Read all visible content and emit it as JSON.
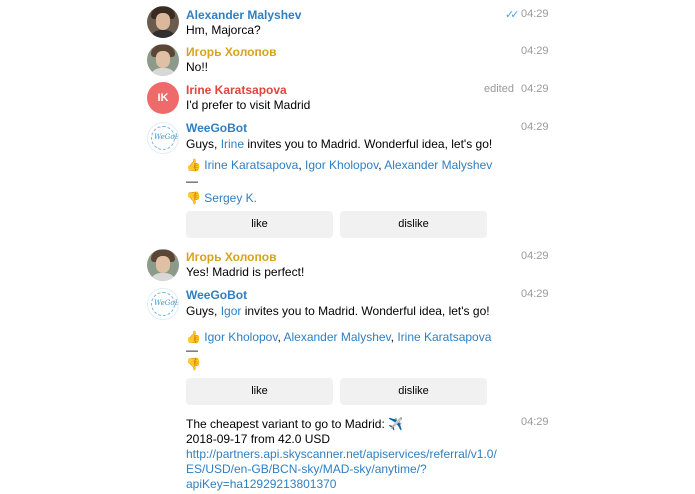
{
  "messages": [
    {
      "author": "Alexander Malyshev",
      "text": "Hm, Majorca?",
      "time": "04:29",
      "status_icon": "double-check-icon"
    },
    {
      "author": "Игорь Холопов",
      "text": "No!!",
      "time": "04:29"
    },
    {
      "author": "Irine Karatsapova",
      "avatar_initials": "IK",
      "text": "I'd prefer to visit Madrid",
      "time": "04:29",
      "edited": "edited"
    },
    {
      "author": "WeeGoBot",
      "avatar_logo": "WeGoBot",
      "time": "04:29",
      "line_pre": "Guys, ",
      "mention": "Irine",
      "line_post": " invites you to Madrid. Wonderful idea, let's go!",
      "like_emoji": "👍",
      "like_names": [
        "Irine Karatsapova",
        "Igor Kholopov",
        "Alexander Malyshev"
      ],
      "separator": "—",
      "dislike_emoji": "👎",
      "dislike_names": [
        "Sergey K."
      ],
      "buttons": {
        "like": "like",
        "dislike": "dislike"
      }
    },
    {
      "author": "Игорь Холопов",
      "text": "Yes! Madrid is perfect!",
      "time": "04:29"
    },
    {
      "author": "WeeGoBot",
      "avatar_logo": "WeGoBot",
      "time": "04:29",
      "line_pre": "Guys, ",
      "mention": "Igor",
      "line_post": " invites you to Madrid. Wonderful idea, let's go!",
      "like_emoji": "👍",
      "like_names": [
        "Igor Kholopov",
        "Alexander Malyshev",
        "Irine Karatsapova"
      ],
      "separator": "—",
      "dislike_emoji": "👎",
      "buttons": {
        "like": "like",
        "dislike": "dislike"
      }
    },
    {
      "time": "04:29",
      "line1": "The cheapest variant to go to Madrid: ✈️",
      "line2": "2018-09-17 from 42.0 USD",
      "link_lines": [
        "http://partners.api.skyscanner.net/apiservices/referral/v1.0/",
        "ES/USD/en-GB/BCN-sky/MAD-sky/anytime/?",
        "apiKey=ha12929213801370"
      ]
    }
  ],
  "colors": {
    "alexander": "#2f7fc2",
    "igor": "#d9a21b",
    "irine": "#e0443c",
    "bot": "#2f7fc2",
    "link": "#2f7fc2",
    "ik_avatar": "#ef6a6a"
  }
}
